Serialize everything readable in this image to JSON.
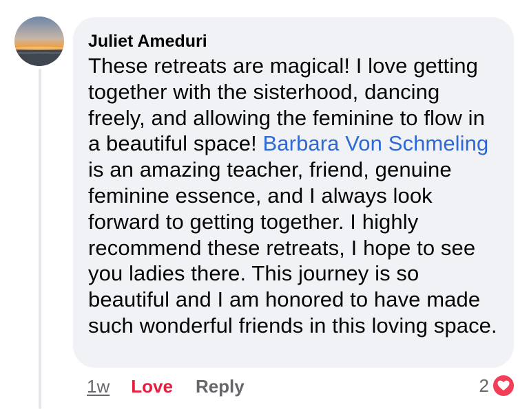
{
  "comment": {
    "author": "Juliet Ameduri",
    "text_before_mention": "These retreats are magical! I love getting together with the sisterhood, dancing freely, and allowing the feminine to flow in a beautiful space! ",
    "mention": "Barbara Von Schmeling",
    "text_after_mention": " is an amazing teacher, friend, genuine feminine essence, and I always look forward to getting together. I highly recommend these retreats, I hope to see you ladies there. This journey is so beautiful and I am honored to have made such wonderful friends in this loving space."
  },
  "actions": {
    "time": "1w",
    "love_label": "Love",
    "reply_label": "Reply"
  },
  "reactions": {
    "count": "2",
    "icon": "heart-icon"
  },
  "colors": {
    "bubble": "#f0f2f5",
    "mention": "#2d68d4",
    "love": "#e41e3f",
    "muted": "#65676b",
    "heart": "#f33e58"
  }
}
